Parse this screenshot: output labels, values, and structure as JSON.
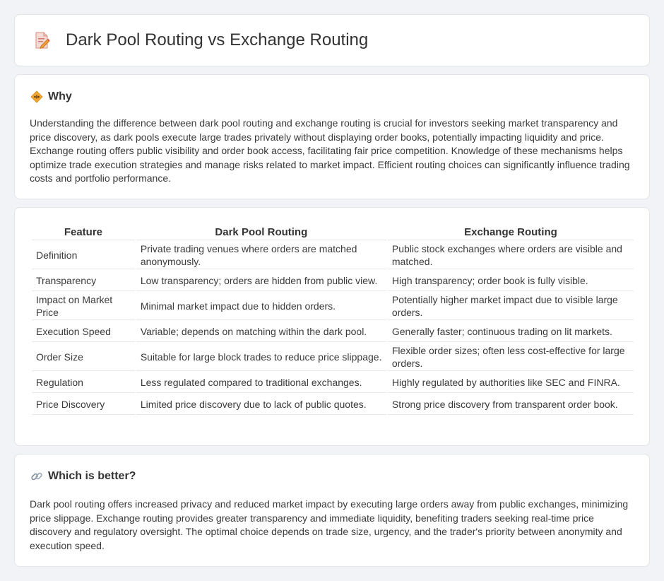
{
  "header": {
    "title": "Dark Pool Routing vs Exchange Routing",
    "icon": "document-pen-icon"
  },
  "why": {
    "heading": "Why",
    "icon": "diamond-sign-icon",
    "text": "Understanding the difference between dark pool routing and exchange routing is crucial for investors seeking market transparency and price discovery, as dark pools execute large trades privately without displaying order books, potentially impacting liquidity and price. Exchange routing offers public visibility and order book access, facilitating fair price competition. Knowledge of these mechanisms helps optimize trade execution strategies and manage risks related to market impact. Efficient routing choices can significantly influence trading costs and portfolio performance."
  },
  "table": {
    "headers": [
      "Feature",
      "Dark Pool Routing",
      "Exchange Routing"
    ],
    "rows": [
      [
        "Definition",
        "Private trading venues where orders are matched anonymously.",
        "Public stock exchanges where orders are visible and matched."
      ],
      [
        "Transparency",
        "Low transparency; orders are hidden from public view.",
        "High transparency; order book is fully visible."
      ],
      [
        "Impact on Market Price",
        "Minimal market impact due to hidden orders.",
        "Potentially higher market impact due to visible large orders."
      ],
      [
        "Execution Speed",
        "Variable; depends on matching within the dark pool.",
        "Generally faster; continuous trading on lit markets."
      ],
      [
        "Order Size",
        "Suitable for large block trades to reduce price slippage.",
        "Flexible order sizes; often less cost-effective for large orders."
      ],
      [
        "Regulation",
        "Less regulated compared to traditional exchanges.",
        "Highly regulated by authorities like SEC and FINRA."
      ],
      [
        "Price Discovery",
        "Limited price discovery due to lack of public quotes.",
        "Strong price discovery from transparent order book."
      ]
    ]
  },
  "better": {
    "heading": "Which is better?",
    "icon": "link-icon",
    "text": "Dark pool routing offers increased privacy and reduced market impact by executing large orders away from public exchanges, minimizing price slippage. Exchange routing provides greater transparency and immediate liquidity, benefiting traders seeking real-time price discovery and regulatory oversight. The optimal choice depends on trade size, urgency, and the trader's priority between anonymity and execution speed."
  },
  "colors": {
    "background": "#f1f3f6",
    "card": "#ffffff",
    "accent_orange": "#f0a030",
    "text": "#333333"
  }
}
